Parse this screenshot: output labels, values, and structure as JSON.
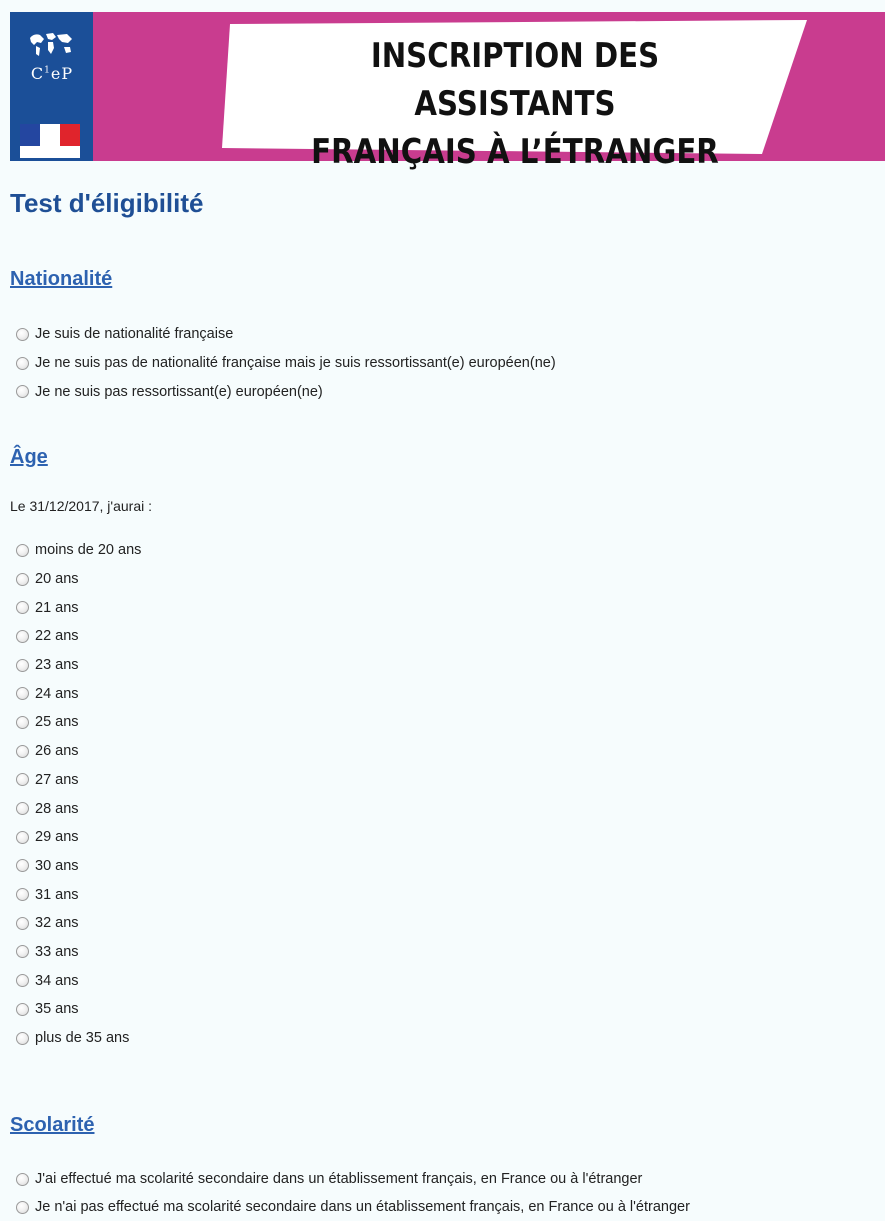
{
  "header": {
    "logo_text": "C",
    "logo_sup": "1",
    "logo_text2": "eP",
    "banner_line1": "INSCRIPTION DES ASSISTANTS",
    "banner_line2": "FRANÇAIS À L’ÉTRANGER"
  },
  "page": {
    "title": "Test d'éligibilité"
  },
  "nationalite": {
    "title": "Nationalité",
    "options": [
      "Je suis de nationalité française",
      "Je ne suis pas de nationalité française mais je suis ressortissant(e) européen(ne)",
      "Je ne suis pas ressortissant(e) européen(ne)"
    ]
  },
  "age": {
    "title": "Âge",
    "intro": "Le 31/12/2017, j'aurai :",
    "options": [
      "moins de 20 ans",
      "20 ans",
      "21 ans",
      "22 ans",
      "23 ans",
      "24 ans",
      "25 ans",
      "26 ans",
      "27 ans",
      "28 ans",
      "29 ans",
      "30 ans",
      "31 ans",
      "32 ans",
      "33 ans",
      "34 ans",
      "35 ans",
      "plus de 35 ans"
    ]
  },
  "scolarite": {
    "title": "Scolarité",
    "options": [
      "J'ai effectué ma scolarité secondaire dans un établissement français, en France ou à l'étranger",
      "Je n'ai pas effectué ma scolarité secondaire dans un établissement français, en France ou à l'étranger"
    ]
  },
  "colors": {
    "header_pink": "#c93c8f",
    "logo_blue": "#1b4f98",
    "title_blue": "#1f4f95",
    "section_blue": "#2d62b0",
    "background": "#f6fcfd"
  }
}
